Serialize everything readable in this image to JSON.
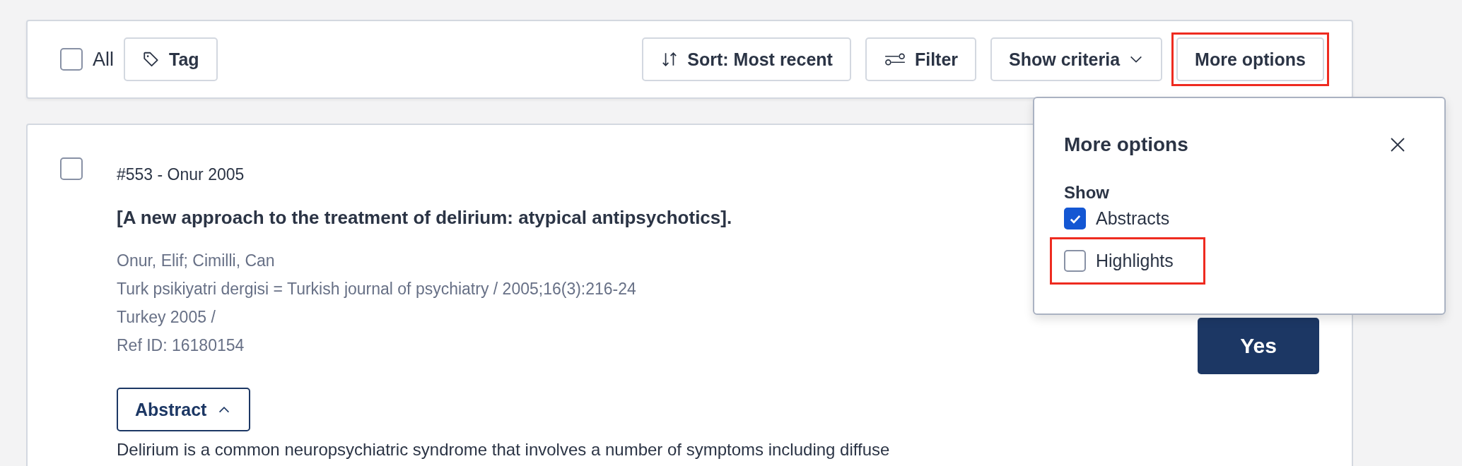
{
  "toolbar": {
    "select_all": {
      "label": "All",
      "checked": false
    },
    "tag_button": "Tag",
    "buttons": [
      {
        "kind": "sort",
        "label": "Sort: Most recent",
        "annotated": false
      },
      {
        "kind": "filter",
        "label": "Filter",
        "annotated": false
      },
      {
        "kind": "dropdown",
        "label": "Show criteria",
        "annotated": false
      },
      {
        "kind": "plain",
        "label": "More options",
        "annotated": true
      }
    ]
  },
  "reference": {
    "checked": false,
    "heading": "#553 - Onur 2005",
    "title": "[A new approach to the treatment of delirium: atypical antipsychotics].",
    "details": [
      "Onur, Elif; Cimilli, Can",
      "Turk psikiyatri dergisi = Turkish journal of psychiatry / 2005;16(3):216-24",
      "Turkey 2005 /",
      "Ref ID: 16180154"
    ],
    "abstract_button": {
      "label": "Abstract",
      "expanded": true
    },
    "abstract": "Delirium is a common neuropsychiatric syndrome that involves a number of symptoms including diffuse",
    "decision_button": "Yes"
  },
  "popover": {
    "title": "More options",
    "section": "Show",
    "options": [
      {
        "label": "Abstracts",
        "checked": true,
        "annotated": false
      },
      {
        "label": "Highlights",
        "checked": false,
        "annotated": true
      }
    ]
  }
}
